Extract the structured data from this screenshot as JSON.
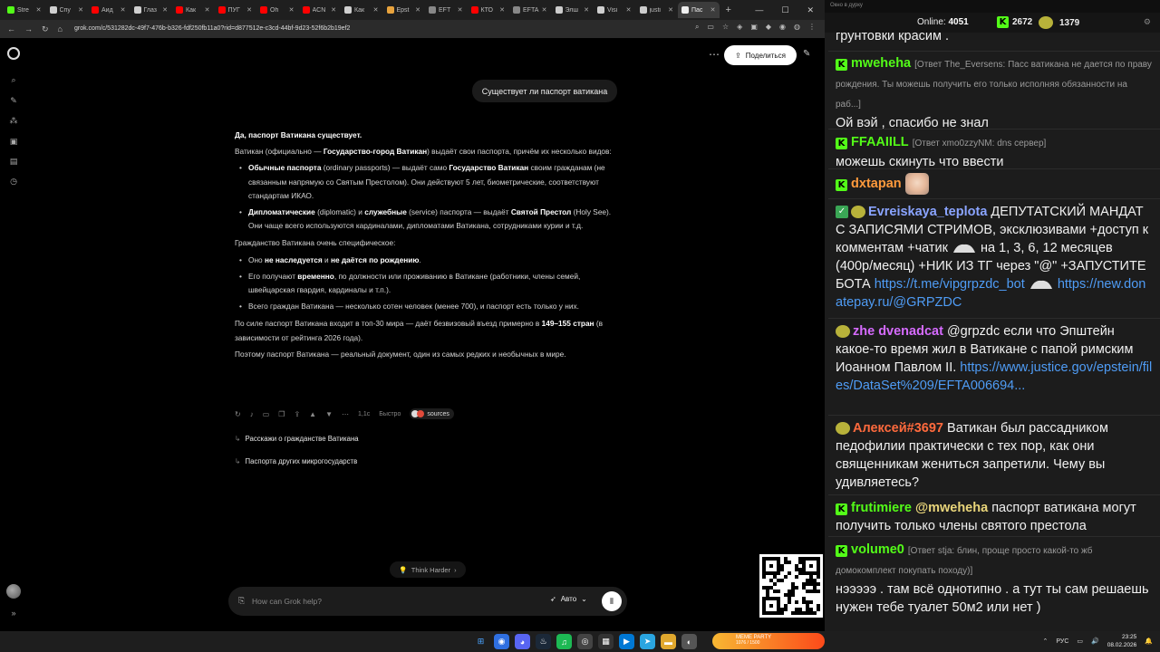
{
  "browser": {
    "tabs": [
      {
        "label": "Stre",
        "color": "#53fc18"
      },
      {
        "label": "Спу",
        "color": "#d0d0d0"
      },
      {
        "label": "Аид",
        "color": "#ff0000"
      },
      {
        "label": "Глаз",
        "color": "#d0d0d0"
      },
      {
        "label": "Как",
        "color": "#ff0000"
      },
      {
        "label": "ПУГ",
        "color": "#ff0000"
      },
      {
        "label": "Oh",
        "color": "#ff0000"
      },
      {
        "label": "ACN",
        "color": "#ff0000"
      },
      {
        "label": "Как",
        "color": "#d0d0d0"
      },
      {
        "label": "Epst",
        "color": "#e8a33d"
      },
      {
        "label": "EFT",
        "color": "#888888"
      },
      {
        "label": "КТО",
        "color": "#ff0000"
      },
      {
        "label": "EFTA",
        "color": "#888888"
      },
      {
        "label": "Элш",
        "color": "#cccccc"
      },
      {
        "label": "Visi",
        "color": "#d0d0d0"
      },
      {
        "label": "justi",
        "color": "#cccccc"
      },
      {
        "label": "Пас",
        "color": "#eeeeee"
      }
    ],
    "active_tab": 16,
    "new_tab": "+",
    "url": "grok.com/c/531282dc-49f7-476b-b326-fdf250fb11a0?rid=d877512e-c3cd-44bf-9d23-52f6b2b19ef2"
  },
  "grok": {
    "share_label": "Поделиться",
    "user_message": "Существует ли паспорт ватикана",
    "answer": {
      "heading": "Да, паспорт Ватикана существует.",
      "intro_1": "Ватикан (официально — ",
      "intro_bold": "Государство-город Ватикан",
      "intro_2": ") выдаёт свои паспорта, причём их несколько видов:",
      "types": [
        {
          "b1": "Обычные паспорта",
          "t1": " (ordinary passports) — выдаёт само ",
          "b2": "Государство Ватикан",
          "t2": " своим гражданам (не связанным напрямую со Святым Престолом). Они действуют 5 лет, биометрические, соответствуют стандартам ИКАО."
        },
        {
          "b1": "Дипломатические",
          "t1": " (diplomatic) и ",
          "b2": "служебные",
          "t2": " (service) паспорта — выдаёт ",
          "b3": "Святой Престол",
          "t3": " (Holy See). Они чаще всего используются кардиналами, дипломатами Ватикана, сотрудниками курии и т.д."
        }
      ],
      "citizenship_intro": "Гражданство Ватикана очень специфическое:",
      "citizenship": [
        {
          "t1": "Оно ",
          "b1": "не наследуется",
          "t2": " и ",
          "b2": "не даётся по рождению",
          "t3": "."
        },
        {
          "t1": "Его получают ",
          "b1": "временно",
          "t2": ", по должности или проживанию в Ватикане (работники, члены семей, швейцарская гвардия, кардиналы и т.п.).",
          "b2": "",
          "t3": ""
        },
        {
          "t1": "Всего граждан Ватикана — несколько сотен человек (менее 700), и паспорт есть только у них.",
          "b1": "",
          "t2": "",
          "b2": "",
          "t3": ""
        }
      ],
      "power_1": "По силе паспорт Ватикана входит в топ-30 мира — даёт безвизовый въезд примерно в ",
      "power_bold": "149–155 стран",
      "power_2": " (в зависимости от рейтинга 2026 года).",
      "conclusion": "Поэтому паспорт Ватикана — реальный документ, один из самых редких и необычных в мире."
    },
    "meta_time": "1,1с",
    "meta_mode": "Быстро",
    "sources_label": "sources",
    "followups": [
      "Расскажи о гражданстве Ватикана",
      "Паспорта других микрогосударств"
    ],
    "think_label": "Think Harder",
    "composer_placeholder": "How can Grok help?",
    "model_label": "Авто"
  },
  "chat": {
    "window_title": "Окно в дурку",
    "online_label": "Online:",
    "online_count": "4051",
    "kick_count": "2672",
    "pepe_count": "1379",
    "partial_line": "грунтовки красим .",
    "messages": [
      {
        "user": "mweheha",
        "user_color": "#53fc18",
        "reply": "[Ответ The_Eversens: Пасс ватикана не дается по праву рождения. Ты можешь получить его только исполняя обязанности на раб...]",
        "text": "Ой вэй , спасибо не знал"
      },
      {
        "user": "FFAAIILL",
        "user_color": "#53fc18",
        "reply": "[Ответ xmo0zzyNM: dns сервер]",
        "text": "можешь скинуть что ввести"
      },
      {
        "user": "dxtapan",
        "user_color": "#ff9a3c",
        "text": ""
      },
      {
        "user": "Evreiskaya_teplota",
        "user_color": "#8aa4ff",
        "text_1": "ДЕПУТАТСКИЙ МАНДАТ С ЗАПИСЯМИ СТРИМОВ, эксклюзивами +доступ к комментам +чатик",
        "text_2": "на 1, 3, 6, 12 месяцев (400р/месяц) +НИК ИЗ ТГ через \"@\" +ЗАПУСТИТЕ БОТА",
        "link_1": "https://t.me/vipgrpzdc_bot",
        "link_2": "https://new.donatepay.ru/@GRPZDC"
      },
      {
        "user": "zhe dvenadcat",
        "user_color": "#d66bff",
        "text": "@grpzdc если что Эпштейн какое-то время жил в Ватикане с папой римским Иоанном  Павлом II.",
        "link": "https://www.justice.gov/epstein/files/DataSet%209/EFTA006694..."
      },
      {
        "user": "Алексей#3697",
        "user_color": "#ff6a3d",
        "text": "Ватикан был рассадником педофилии практически с тех пор, как они священникам жениться запретили. Чему вы удивляетесь?"
      },
      {
        "user": "frutimiere",
        "user_color": "#53fc18",
        "mention": "@mweheha",
        "text": "паспорт ватикана могут получить только члены святого престола"
      },
      {
        "user": "volume0",
        "user_color": "#53fc18",
        "reply": "[Ответ stja: блин, проще просто какой-то жб домокомплект покупать походу)]",
        "text": "нэээээ . там всё однотипно . а тут ты сам решаешь нужен тебе туалет 50м2 или нет )"
      }
    ]
  },
  "taskbar": {
    "meme_party_label": "MEME PARTY",
    "meme_party_progress": "1076 / 1500",
    "lang": "РУС",
    "time": "23:25",
    "date": "08.02.2026"
  }
}
